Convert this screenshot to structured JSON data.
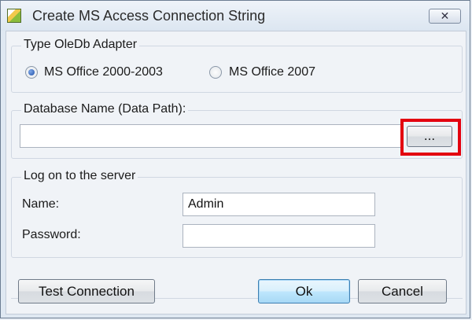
{
  "window": {
    "title": "Create MS Access Connection String",
    "close_label": "✕"
  },
  "adapter_group": {
    "legend": "Type OleDb Adapter",
    "options": [
      {
        "label": "MS Office 2000-2003",
        "selected": true
      },
      {
        "label": "MS Office 2007",
        "selected": false
      }
    ]
  },
  "database_group": {
    "legend": "Database Name (Data Path):",
    "path_value": "",
    "browse_label": "..."
  },
  "logon_group": {
    "legend": "Log on to the server",
    "name_label": "Name:",
    "name_value": "Admin",
    "password_label": "Password:",
    "password_value": ""
  },
  "buttons": {
    "test": "Test Connection",
    "ok": "Ok",
    "cancel": "Cancel"
  },
  "colors": {
    "highlight": "#e3000f",
    "default_button_border": "#3c7fb1"
  }
}
